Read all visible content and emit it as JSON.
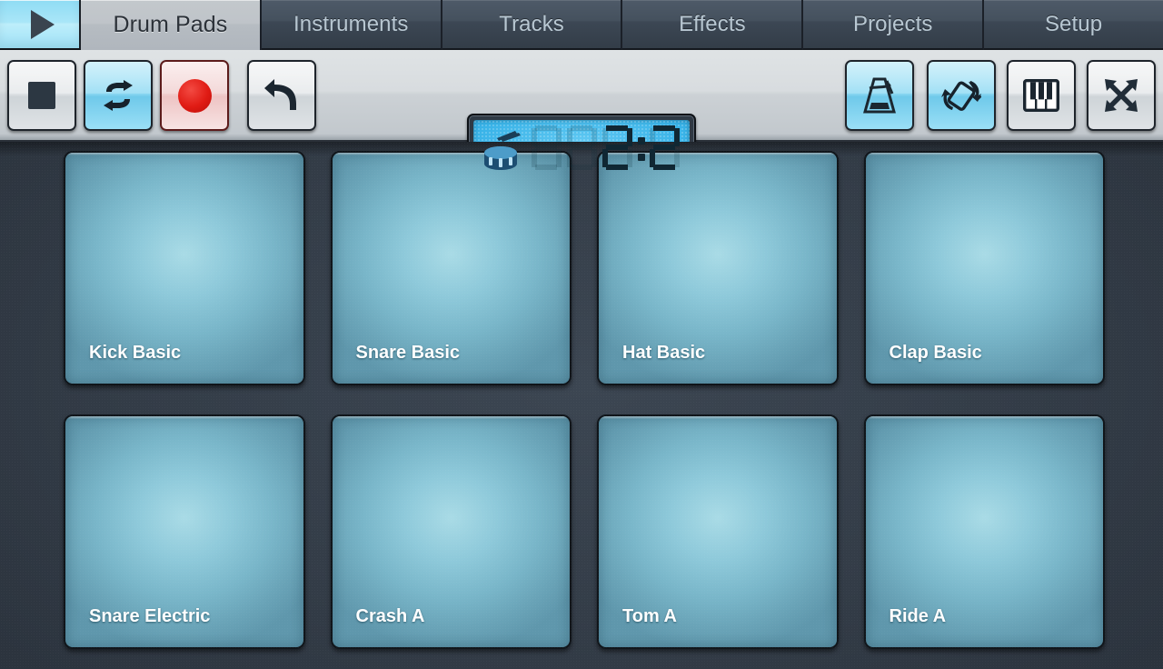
{
  "app": {
    "title": "Drum Pads",
    "accent_cyan": "#8fdcf4",
    "accent_red": "#e01b14",
    "pad_color": "#8ec9da",
    "background": "#333c47"
  },
  "tabbar": {
    "play_button": {
      "label": "Play",
      "icon": "play-icon"
    },
    "tabs": [
      {
        "label": "Drum Pads",
        "active": true
      },
      {
        "label": "Instruments",
        "active": false
      },
      {
        "label": "Tracks",
        "active": false
      },
      {
        "label": "Effects",
        "active": false
      },
      {
        "label": "Projects",
        "active": false
      },
      {
        "label": "Setup",
        "active": false
      }
    ]
  },
  "toolbar": {
    "left_buttons": [
      {
        "name": "stop-button",
        "label": "Stop",
        "icon": "stop-icon",
        "active": false
      },
      {
        "name": "loop-button",
        "label": "Loop",
        "icon": "loop-icon",
        "active": true
      },
      {
        "name": "record-button",
        "label": "Record",
        "icon": "record-icon",
        "active": false
      },
      {
        "name": "undo-button",
        "label": "Undo",
        "icon": "undo-arrow-icon",
        "active": false
      }
    ],
    "right_buttons": [
      {
        "name": "metronome-button",
        "label": "Metronome",
        "icon": "metronome-icon",
        "active": true
      },
      {
        "name": "rotate-button",
        "label": "Rotate Screen",
        "icon": "rotate-icon",
        "active": true
      },
      {
        "name": "keyboard-button",
        "label": "Keyboard",
        "icon": "piano-keys-icon",
        "active": false
      },
      {
        "name": "fullscreen-button",
        "label": "Fullscreen",
        "icon": "expand-arrows-icon",
        "active": false
      }
    ],
    "display": {
      "icon": "snare-drum-icon",
      "ghost": "888",
      "value": "2:2",
      "bar": "2",
      "beat": "2",
      "digits": [
        {
          "char": "8",
          "on": false
        },
        {
          "char": "8",
          "on": false
        },
        {
          "char": "2",
          "on": true
        },
        {
          "char": "2",
          "on": true
        }
      ]
    }
  },
  "pads": [
    {
      "label": "Kick Basic"
    },
    {
      "label": "Snare Basic"
    },
    {
      "label": "Hat Basic"
    },
    {
      "label": "Clap Basic"
    },
    {
      "label": "Snare Electric"
    },
    {
      "label": "Crash A"
    },
    {
      "label": "Tom A"
    },
    {
      "label": "Ride A"
    }
  ]
}
